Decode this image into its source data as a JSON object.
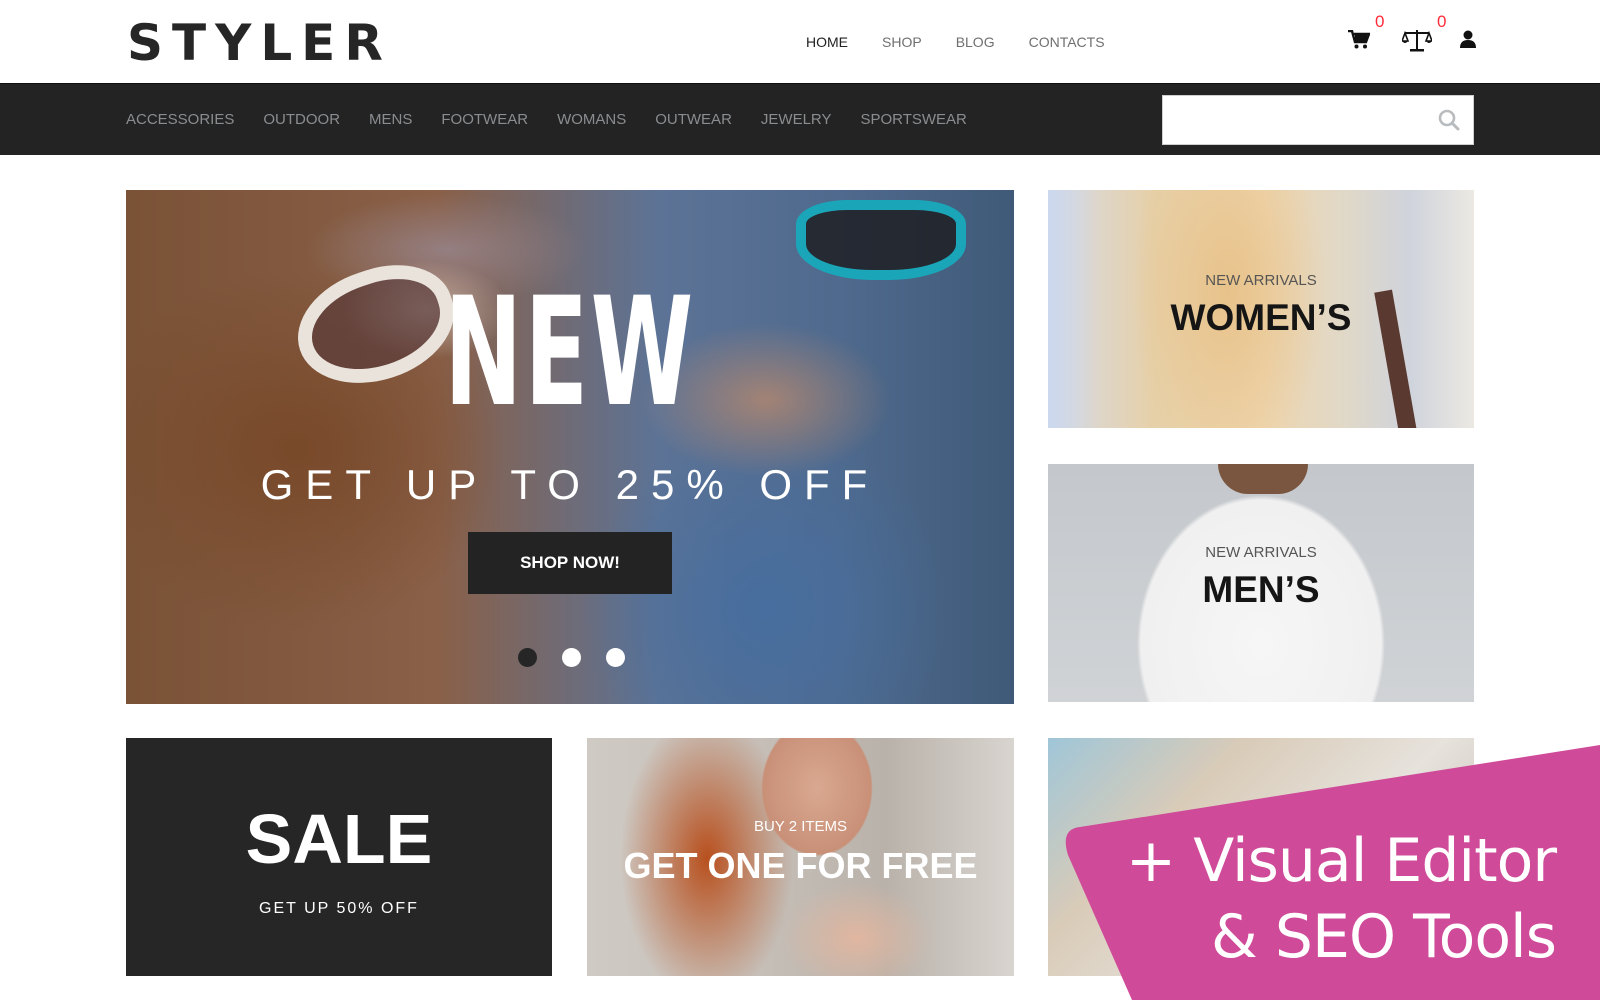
{
  "brand": {
    "logo": "STYLER"
  },
  "main_nav": [
    {
      "label": "HOME",
      "active": true
    },
    {
      "label": "SHOP",
      "active": false
    },
    {
      "label": "BLOG",
      "active": false
    },
    {
      "label": "CONTACTS",
      "active": false
    }
  ],
  "header_icons": {
    "cart": {
      "icon": "shopping-cart-icon",
      "count": "0"
    },
    "compare": {
      "icon": "balance-scale-icon",
      "count": "0"
    },
    "account": {
      "icon": "user-icon"
    }
  },
  "categories": [
    "ACCESSORIES",
    "OUTDOOR",
    "MENS",
    "FOOTWEAR",
    "WOMANS",
    "OUTWEAR",
    "JEWELRY",
    "SPORTSWEAR"
  ],
  "search": {
    "value": "",
    "placeholder": "",
    "icon": "search-icon"
  },
  "hero": {
    "title": "NEW",
    "subtitle": "GET UP TO 25% OFF",
    "button": "SHOP NOW!",
    "slides_total": 3,
    "active_slide": 1
  },
  "banners": {
    "women": {
      "kicker": "NEW ARRIVALS",
      "title": "WOMEN’S"
    },
    "men": {
      "kicker": "NEW ARRIVALS",
      "title": "MEN’S"
    }
  },
  "sale": {
    "title": "SALE",
    "subtitle": "GET UP 50% OFF"
  },
  "promo": {
    "kicker": "BUY 2 ITEMS",
    "title": "GET ONE FOR FREE"
  },
  "overlay": {
    "line1": "+ Visual Editor",
    "line2": "& SEO Tools",
    "color": "#cf4a98"
  },
  "colors": {
    "dark": "#232323",
    "badge": "#ff2b3a",
    "nav_inactive": "#6f6f6f",
    "category_text": "#8a8d90"
  }
}
